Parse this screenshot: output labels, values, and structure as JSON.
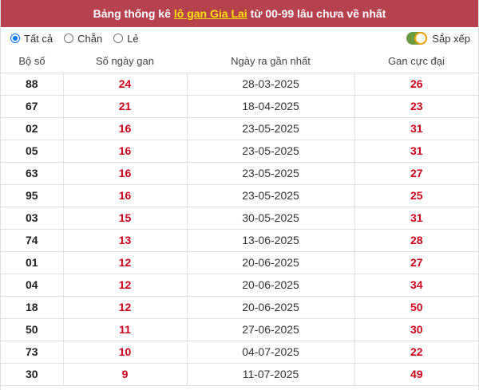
{
  "header": {
    "title_prefix": "Bảng thống kê",
    "title_link": "lô gan Gia Lai",
    "title_suffix": "từ 00-99 lâu chưa về nhất"
  },
  "filters": {
    "options": [
      {
        "label": "Tất cả",
        "selected": true
      },
      {
        "label": "Chẵn",
        "selected": false
      },
      {
        "label": "Lẻ",
        "selected": false
      }
    ],
    "sort_label": "Sắp xếp",
    "sort_on": true
  },
  "table": {
    "columns": [
      "Bộ số",
      "Số ngày gan",
      "Ngày ra gần nhất",
      "Gan cực đại"
    ],
    "rows": [
      {
        "num": "88",
        "days": "24",
        "date": "28-03-2025",
        "max": "26"
      },
      {
        "num": "67",
        "days": "21",
        "date": "18-04-2025",
        "max": "23"
      },
      {
        "num": "02",
        "days": "16",
        "date": "23-05-2025",
        "max": "31"
      },
      {
        "num": "05",
        "days": "16",
        "date": "23-05-2025",
        "max": "31"
      },
      {
        "num": "63",
        "days": "16",
        "date": "23-05-2025",
        "max": "27"
      },
      {
        "num": "95",
        "days": "16",
        "date": "23-05-2025",
        "max": "25"
      },
      {
        "num": "03",
        "days": "15",
        "date": "30-05-2025",
        "max": "31"
      },
      {
        "num": "74",
        "days": "13",
        "date": "13-06-2025",
        "max": "28"
      },
      {
        "num": "01",
        "days": "12",
        "date": "20-06-2025",
        "max": "27"
      },
      {
        "num": "04",
        "days": "12",
        "date": "20-06-2025",
        "max": "34"
      },
      {
        "num": "18",
        "days": "12",
        "date": "20-06-2025",
        "max": "50"
      },
      {
        "num": "50",
        "days": "11",
        "date": "27-06-2025",
        "max": "30"
      },
      {
        "num": "73",
        "days": "10",
        "date": "04-07-2025",
        "max": "22"
      },
      {
        "num": "30",
        "days": "9",
        "date": "11-07-2025",
        "max": "49"
      }
    ]
  },
  "colors": {
    "header_bg": "#b5424c",
    "link": "#ffe100",
    "value_red": "#d0021b",
    "radio_blue": "#0075ff",
    "toggle_green": "#6b9a3f",
    "toggle_knob_border": "#f0a202"
  }
}
